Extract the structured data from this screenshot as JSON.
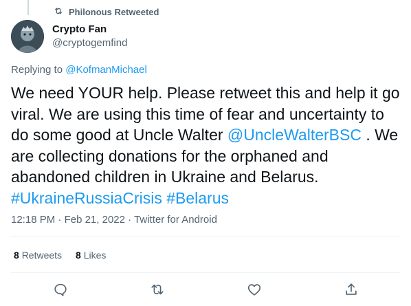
{
  "retweet_banner": {
    "text": "Philonous Retweeted",
    "icon": "retweet-icon"
  },
  "author": {
    "display_name": "Crypto Fan",
    "handle": "@cryptogemfind",
    "avatar": "avatar-image"
  },
  "reply": {
    "prefix": "Replying to",
    "mention": "@KofmanMichael"
  },
  "tweet": {
    "text_1": "We need YOUR help. Please retweet this and help it go viral. We are using this time of fear and uncertainty to do some good at Uncle Walter ",
    "mention": "@UncleWalterBSC",
    "text_2": " . We are collecting donations for the orphaned and abandoned children in Ukraine and Belarus.",
    "hashtag_1": "#UkraineRussiaCrisis",
    "hashtag_2": "#Belarus"
  },
  "meta": {
    "time": "12:18 PM",
    "date": "Feb 21, 2022",
    "source": "Twitter for Android",
    "separator": "·"
  },
  "stats": {
    "retweets_count": "8",
    "retweets_label": "Retweets",
    "likes_count": "8",
    "likes_label": "Likes"
  },
  "actions": [
    "reply-icon",
    "retweet-icon",
    "like-icon",
    "share-icon"
  ],
  "colors": {
    "link": "#1d9bf0",
    "secondary": "#536471",
    "text": "#0f1419",
    "divider": "#eff3f4"
  }
}
